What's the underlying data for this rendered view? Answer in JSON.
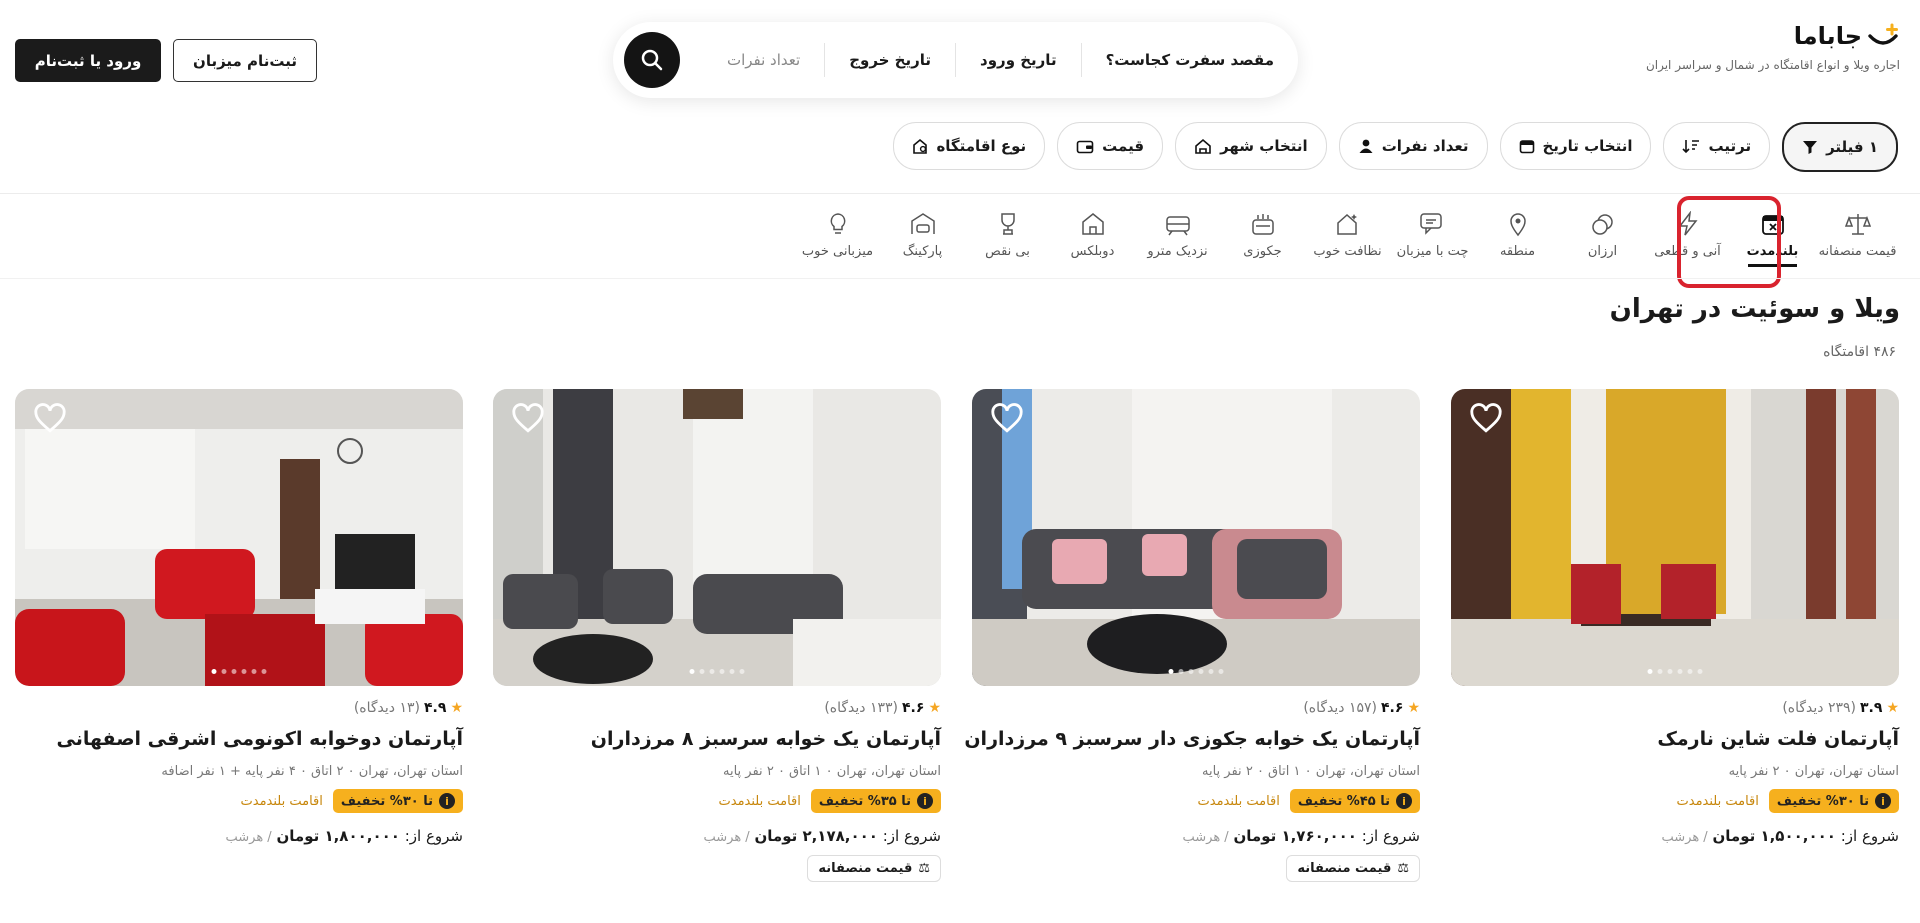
{
  "header": {
    "logo_name": "جاباما",
    "tagline": "اجاره ویلا و انواع اقامتگاه در شمال و سراسر ایران",
    "search": {
      "destination": "مقصد سفرت کجاست؟",
      "checkin": "تاریخ ورود",
      "checkout": "تاریخ خروج",
      "guests": "تعداد نفرات"
    },
    "host_button": "ثبت‌نام میزبان",
    "login_button": "ورود یا ثبت‌نام"
  },
  "filters": [
    {
      "label": "۱ فیلتر",
      "icon": "filter-icon"
    },
    {
      "label": "ترتیب",
      "icon": "sort-icon"
    },
    {
      "label": "انتخاب تاریخ",
      "icon": "calendar-icon"
    },
    {
      "label": "تعداد نفرات",
      "icon": "person-icon"
    },
    {
      "label": "انتخاب شهر",
      "icon": "city-icon"
    },
    {
      "label": "قیمت",
      "icon": "wallet-icon"
    },
    {
      "label": "نوع اقامتگاه",
      "icon": "home-type-icon"
    }
  ],
  "categories": [
    {
      "label": "قیمت منصفانه",
      "icon": "scale-icon"
    },
    {
      "label": "بلندمدت",
      "icon": "calendar-x-icon",
      "active": true
    },
    {
      "label": "آنی و قطعی",
      "icon": "lightning-icon"
    },
    {
      "label": "ارزان",
      "icon": "coin-icon"
    },
    {
      "label": "منطقه",
      "icon": "pin-icon"
    },
    {
      "label": "چت با میزبان",
      "icon": "chat-icon"
    },
    {
      "label": "نظافت خوب",
      "icon": "sparkle-home-icon"
    },
    {
      "label": "جکوزی",
      "icon": "jacuzzi-icon"
    },
    {
      "label": "نزدیک مترو",
      "icon": "metro-icon"
    },
    {
      "label": "دوبلکس",
      "icon": "duplex-icon"
    },
    {
      "label": "بی نقص",
      "icon": "trophy-icon"
    },
    {
      "label": "پارکینگ",
      "icon": "garage-icon"
    },
    {
      "label": "میزبانی خوب",
      "icon": "bulb-icon"
    }
  ],
  "listing": {
    "title": "ویلا و سوئیت در تهران",
    "count": "۴۸۶ اقامتگاه"
  },
  "cards": [
    {
      "rating": "۳.۹",
      "reviews": "(۲۳۹ دیدگاه)",
      "title": "آپارتمان فلت شاین نارمک",
      "location": "استان تهران، تهران ۰ ۲ نفر پایه",
      "discount": "تا ۳۰% تخفیف",
      "longstay": "اقامت بلندمدت",
      "price_prefix": "شروع از:",
      "price": "۱,۵۰۰,۰۰۰ تومان",
      "per": "/ هرشب",
      "fair_price": ""
    },
    {
      "rating": "۴.۶",
      "reviews": "(۱۵۷ دیدگاه)",
      "title": "آپارتمان یک خوابه جکوزی دار سرسبز ۹ مرزداران",
      "location": "استان تهران، تهران ۰ ۱ اتاق ۰ ۲ نفر پایه",
      "discount": "تا ۴۵% تخفیف",
      "longstay": "اقامت بلندمدت",
      "price_prefix": "شروع از:",
      "price": "۱,۷۶۰,۰۰۰ تومان",
      "per": "/ هرشب",
      "fair_price": "قیمت منصفانه"
    },
    {
      "rating": "۴.۶",
      "reviews": "(۱۳۳ دیدگاه)",
      "title": "آپارتمان یک خوابه سرسبز ۸ مرزداران",
      "location": "استان تهران، تهران ۰ ۱ اتاق ۰ ۲ نفر پایه",
      "discount": "تا ۳۵% تخفیف",
      "longstay": "اقامت بلندمدت",
      "price_prefix": "شروع از:",
      "price": "۲,۱۷۸,۰۰۰ تومان",
      "per": "/ هرشب",
      "fair_price": "قیمت منصفانه"
    },
    {
      "rating": "۴.۹",
      "reviews": "(۱۳ دیدگاه)",
      "title": "آپارتمان دوخوابه اکونومی اشرقی اصفهانی",
      "location": "استان تهران، تهران ۰ ۲ اتاق ۰ ۴ نفر پایه + ۱ نفر اضافه",
      "discount": "تا ۳۰% تخفیف",
      "longstay": "اقامت بلندمدت",
      "price_prefix": "شروع از:",
      "price": "۱,۸۰۰,۰۰۰ تومان",
      "per": "/ هرشب",
      "fair_price": ""
    }
  ]
}
